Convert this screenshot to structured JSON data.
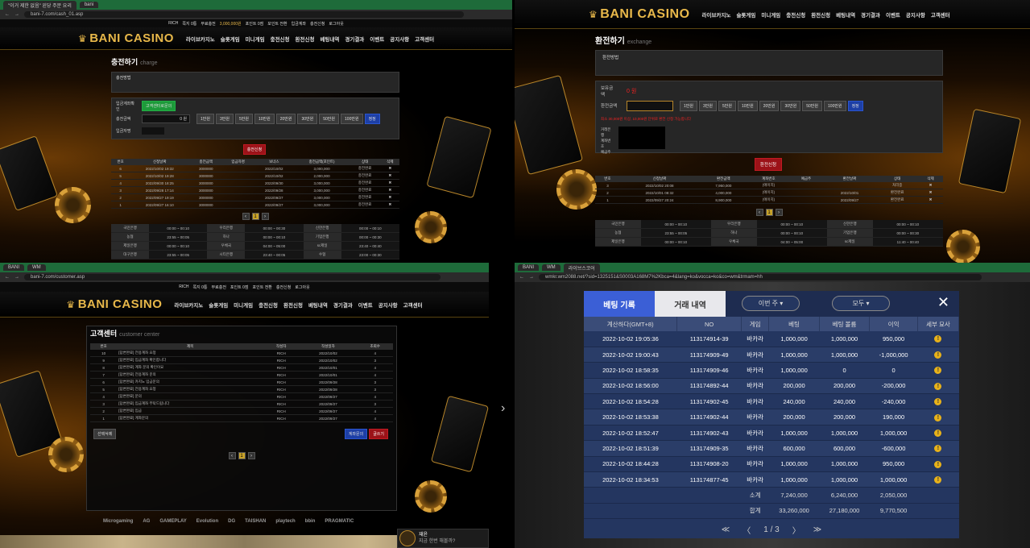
{
  "q1": {
    "chrome": {
      "tab1": "\"이거 제한 없음\" 왼당 주문 요리",
      "tab2": "bani",
      "url": "bani-7.com/cash_01.asp"
    },
    "topbar": [
      "RICH",
      "쪽지 0통",
      "무료충전",
      "3,000,000원",
      "포인트 0점",
      "포인트 전환",
      "입금계좌",
      "충전신청",
      "로그아웃"
    ],
    "logo": "BANI CASINO",
    "nav": [
      "라이브카지노",
      "슬롯게임",
      "미니게임",
      "충전신청",
      "환전신청",
      "베팅내역",
      "경기결과",
      "이벤트",
      "공지사항",
      "고객센터"
    ],
    "title": "충전하기",
    "subtitle": "charge",
    "section": "충전방법",
    "account_label": "입금계좌확인",
    "account_btn": "고객센터로문의",
    "amount_label": "충전금액",
    "amount_value": "0 원",
    "amount_btns": [
      "1만원",
      "3만원",
      "5만원",
      "10만원",
      "20만원",
      "30만원",
      "50만원",
      "100만원",
      "정정"
    ],
    "depositor_label": "입금자명",
    "submit": "충전신청",
    "table_headers": [
      "번호",
      "신청날짜",
      "충전금액",
      "입금자명",
      "보너스",
      "충전금액(포인트)",
      "상태",
      "삭제"
    ],
    "rows": [
      [
        "6",
        "2022/10/02 19:32",
        "3000000",
        "",
        "2022/10/02",
        "3,000,000",
        "충전완료",
        "✖"
      ],
      [
        "5",
        "2022/10/02 19:28",
        "3000000",
        "",
        "2022/10/02",
        "2,000,000",
        "충전완료",
        "✖"
      ],
      [
        "4",
        "2022/09/30 18:25",
        "3000000",
        "",
        "2022/09/30",
        "3,000,000",
        "충전완료",
        "✖"
      ],
      [
        "3",
        "2022/09/28 17:14",
        "3000000",
        "",
        "2022/09/28",
        "3,000,000",
        "충전완료",
        "✖"
      ],
      [
        "2",
        "2022/09/27 19:19",
        "3000000",
        "",
        "2022/09/27",
        "3,000,000",
        "충전완료",
        "✖"
      ],
      [
        "1",
        "2022/09/27 16:10",
        "3000000",
        "",
        "2022/09/27",
        "3,000,000",
        "충전완료",
        "✖"
      ]
    ],
    "page": "1",
    "schedule": [
      [
        "국민은행",
        "00:00 ~ 00:10",
        "우리은행",
        "00:00 ~ 00:30",
        "신한은행",
        "00:00 ~ 00:10"
      ],
      [
        "농협",
        "23:55 ~ 00:05",
        "하나",
        "00:00 ~ 00:10",
        "기업은행",
        "00:00 ~ 00:30"
      ],
      [
        "제일은행",
        "00:00 ~ 00:10",
        "우체국",
        "04:00 ~ 05:00",
        "sc제일",
        "23:40 ~ 00:40"
      ],
      [
        "대구은행",
        "23:55 ~ 00:05",
        "시티은행",
        "23:40 ~ 00:05",
        "수협",
        "23:00 ~ 00:30"
      ]
    ]
  },
  "q2": {
    "logo": "BANI CASINO",
    "nav": [
      "라이브카지노",
      "슬롯게임",
      "미니게임",
      "충전신청",
      "환전신청",
      "베팅내역",
      "경기결과",
      "이벤트",
      "공지사항",
      "고객센터"
    ],
    "title": "환전하기",
    "subtitle": "exchange",
    "section": "환전방법",
    "holding_label": "보유금액",
    "holding_value": "0 원",
    "amount_label": "환전금액",
    "amount_btns": [
      "1만원",
      "3만원",
      "5만원",
      "10만원",
      "20만원",
      "30만원",
      "50만원",
      "100만원",
      "정정"
    ],
    "notice": "최소 30,000원 이상, 10,000원 단위로 환전 신청 가능합니다",
    "account_labels": [
      "거래은행",
      "계좌번호",
      "예금주"
    ],
    "submit": "환전신청",
    "table_headers": [
      "번호",
      "신청날짜",
      "환전금액",
      "계좌번호",
      "예금주",
      "환전날짜",
      "상태",
      "삭제"
    ],
    "rows": [
      [
        "3",
        "2022/10/02 20:08",
        "7,950,000",
        "(에이치)",
        "",
        "",
        "처리중",
        "✖"
      ],
      [
        "2",
        "2022/10/01 08:32",
        "4,000,000",
        "(에이치)",
        "",
        "2022/10/01",
        "환전완료",
        "✖"
      ],
      [
        "1",
        "2022/09/27 20:24",
        "8,900,000",
        "(에이치)",
        "",
        "2022/09/27",
        "환전완료",
        "✖"
      ]
    ],
    "page": "1",
    "schedule": [
      [
        "국민은행",
        "00:00 ~ 00:10",
        "우리은행",
        "00:00 ~ 00:10",
        "신한은행",
        "00:00 ~ 00:10"
      ],
      [
        "농협",
        "23:55 ~ 00:05",
        "하나",
        "00:00 ~ 00:10",
        "기업은행",
        "00:00 ~ 00:30"
      ],
      [
        "제일은행",
        "00:00 ~ 00:10",
        "우체국",
        "04:00 ~ 05:00",
        "sc제일",
        "11:40 ~ 00:40"
      ]
    ]
  },
  "q3": {
    "chrome": {
      "tab1": "BANI",
      "tab2": "WM",
      "url": "bani-7.com/customer.asp"
    },
    "logo": "BANI CASINO",
    "nav": [
      "라이브카지노",
      "슬롯게임",
      "미니게임",
      "충전신청",
      "환전신청",
      "베팅내역",
      "경기결과",
      "이벤트",
      "공지사항",
      "고객센터"
    ],
    "title": "고객센터",
    "subtitle": "customer center",
    "table_headers": [
      "번호",
      "제목",
      "작성자",
      "작성일자",
      "조회수"
    ],
    "rows": [
      [
        "10",
        "[답변완료] 전용계좌 요청",
        "RICH",
        "2022/10/02",
        "4"
      ],
      [
        "9",
        "[답변완료] 입금계좌 확인합니다",
        "RICH",
        "2022/10/02",
        "3"
      ],
      [
        "8",
        "[답변완료] 계좌 문의 확인이요",
        "RICH",
        "2022/10/01",
        "4"
      ],
      [
        "7",
        "[답변완료] 전용계좌 문의",
        "RICH",
        "2022/10/01",
        "4"
      ],
      [
        "6",
        "[답변완료] 카지노 입금문의",
        "RICH",
        "2022/09/28",
        "3"
      ],
      [
        "5",
        "[답변완료] 전용계좌 요청",
        "RICH",
        "2022/09/28",
        "3"
      ],
      [
        "4",
        "[답변완료] 문의",
        "RICH",
        "2022/09/27",
        "4"
      ],
      [
        "3",
        "[답변완료] 입금계좌 부탁드립니다",
        "RICH",
        "2022/09/27",
        "3"
      ],
      [
        "2",
        "[답변완료] 입금",
        "RICH",
        "2022/09/27",
        "4"
      ],
      [
        "1",
        "[답변완료] 계좌문의",
        "RICH",
        "2022/09/27",
        "4"
      ]
    ],
    "select_delete": "선택삭제",
    "btn_blue": "계좌문의",
    "btn_red": "글쓰기",
    "page": "1",
    "footer": [
      "Microgaming",
      "AG",
      "GAMEPLAY",
      "Evolution",
      "DG",
      "TAISHAN",
      "playtech",
      "bbin",
      "PRAGMATIC"
    ],
    "chat": {
      "name": "재윤",
      "msg": "지금 한번 해볼까?"
    }
  },
  "q4": {
    "chrome": {
      "tab1": "BANI",
      "tab2": "WM",
      "tab3": "라이브스코어",
      "url": "wmkr.wm2088.net/?sid=1325151&S0003A168M7%2Kbca=4&lang=ko&vocca=ko&co=wm&trmam=hh"
    },
    "tabs": {
      "active": "베팅 기록",
      "inactive": "거래 내역"
    },
    "select1": "이번 주",
    "select2": "모두",
    "close": "✕",
    "headers": [
      "계산하다(GMT+8)",
      "NO",
      "게임",
      "베팅",
      "베팅 볼륨",
      "이익",
      "세부 묘사"
    ],
    "rows": [
      [
        "2022-10-02 19:05:36",
        "113174914-39",
        "바카라",
        "1,000,000",
        "1,000,000",
        "950,000",
        "pos"
      ],
      [
        "2022-10-02 19:00:43",
        "113174909-49",
        "바카라",
        "1,000,000",
        "1,000,000",
        "-1,000,000",
        "neg"
      ],
      [
        "2022-10-02 18:58:35",
        "113174909-46",
        "바카라",
        "1,000,000",
        "0",
        "0",
        "neg"
      ],
      [
        "2022-10-02 18:56:00",
        "113174892-44",
        "바카라",
        "200,000",
        "200,000",
        "-200,000",
        "neg"
      ],
      [
        "2022-10-02 18:54:28",
        "113174902-45",
        "바카라",
        "240,000",
        "240,000",
        "-240,000",
        "neg"
      ],
      [
        "2022-10-02 18:53:38",
        "113174902-44",
        "바카라",
        "200,000",
        "200,000",
        "190,000",
        "pos"
      ],
      [
        "2022-10-02 18:52:47",
        "113174902-43",
        "바카라",
        "1,000,000",
        "1,000,000",
        "1,000,000",
        "pos"
      ],
      [
        "2022-10-02 18:51:39",
        "113174909-35",
        "바카라",
        "600,000",
        "600,000",
        "-600,000",
        "neg"
      ],
      [
        "2022-10-02 18:44:28",
        "113174908-20",
        "바카라",
        "1,000,000",
        "1,000,000",
        "950,000",
        "pos"
      ],
      [
        "2022-10-02 18:34:53",
        "113174877-45",
        "바카라",
        "1,000,000",
        "1,000,000",
        "1,000,000",
        "pos"
      ]
    ],
    "subtotal": {
      "label": "소계",
      "bet": "7,240,000",
      "volume": "6,240,000",
      "profit": "2,050,000"
    },
    "total": {
      "label": "합계",
      "bet": "33,260,000",
      "volume": "27,180,000",
      "profit": "9,770,500"
    },
    "pager": {
      "first": "≪",
      "prev": "〈",
      "current": "1",
      "sep": "/",
      "total": "3",
      "next": "〉",
      "last": "≫"
    }
  },
  "colors": {
    "gold": "#e8b84a",
    "brand_green": "#1e6b3a",
    "bet_blue": "#243660",
    "active_tab": "#3b5fd6"
  }
}
